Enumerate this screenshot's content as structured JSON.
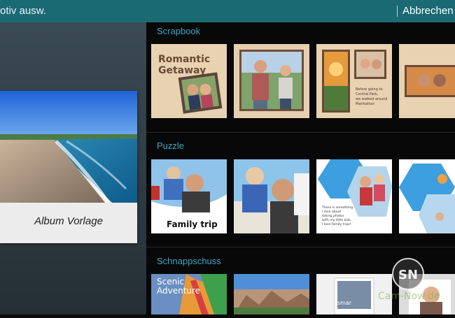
{
  "header": {
    "title": "otiv ausw.",
    "cancel_label": "Abbrechen"
  },
  "preview": {
    "caption": "Album Vorlage"
  },
  "sections": [
    {
      "title": "Scrapbook",
      "thumbs": [
        {
          "name": "romantic-getaway",
          "text": [
            "Romantic",
            "Getaway"
          ]
        },
        {
          "name": "couple-walk",
          "text": []
        },
        {
          "name": "central-park",
          "text": [
            "Before going to",
            "Central Park,",
            "we walked around",
            "Manhattan"
          ]
        },
        {
          "name": "couple-sunset",
          "text": []
        }
      ]
    },
    {
      "title": "Puzzle",
      "thumbs": [
        {
          "name": "family-trip",
          "text": [
            "Family trip"
          ]
        },
        {
          "name": "father-son",
          "text": []
        },
        {
          "name": "hexagon-story",
          "text": [
            "There is something",
            "I love about",
            "taking photos",
            "with my little kids.",
            "I love family trips!"
          ]
        },
        {
          "name": "hexagon-sky",
          "text": []
        }
      ]
    },
    {
      "title": "Schnappschuss",
      "thumbs": [
        {
          "name": "scenic-adventure",
          "text": [
            "Scenic",
            "Adventure"
          ]
        },
        {
          "name": "rock-formation",
          "text": []
        },
        {
          "name": "snapshot-white",
          "text": [
            "smar"
          ]
        },
        {
          "name": "snapshot-girl",
          "text": []
        }
      ]
    }
  ],
  "watermark": {
    "logo": "SN",
    "text": "Cam-Now.de"
  },
  "colors": {
    "header": "#1a6a74",
    "section_title": "#3aa6c4",
    "cancel": "#ffffff"
  }
}
